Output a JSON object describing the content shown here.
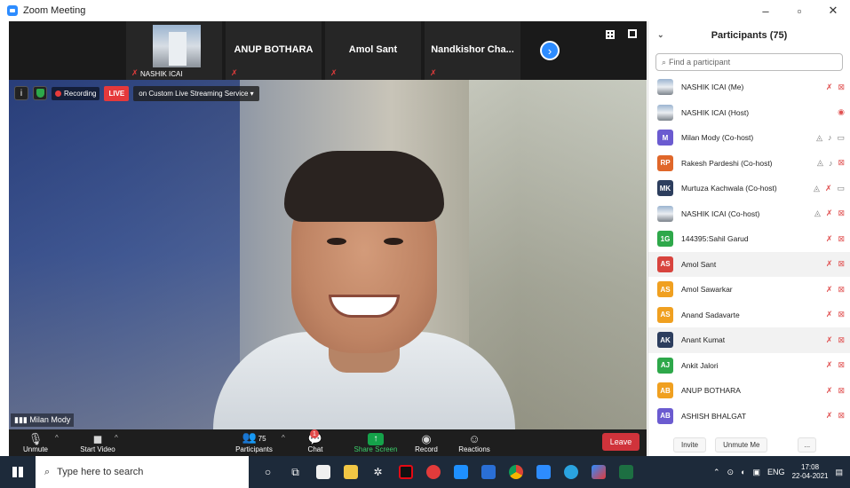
{
  "window": {
    "title": "Zoom Meeting",
    "controls": [
      "–",
      "▫",
      "✕"
    ]
  },
  "thumbnails": [
    {
      "name": "",
      "small_label": "NASHIK ICAI",
      "kind": "image"
    },
    {
      "name": "ANUP BOTHARA",
      "small_label": "",
      "kind": "name"
    },
    {
      "name": "Amol Sant",
      "small_label": "",
      "kind": "name"
    },
    {
      "name": "Nandkishor Cha...",
      "small_label": "",
      "kind": "name"
    }
  ],
  "recording": {
    "recording_label": "Recording",
    "live_label": "LIVE",
    "stream_label": "on Custom Live Streaming Service ▾"
  },
  "speaker": {
    "label": "Milan Mody"
  },
  "toolbar": {
    "unmute": "Unmute",
    "start_video": "Start Video",
    "participants": "Participants",
    "participants_count": "75",
    "chat": "Chat",
    "chat_badge": "1",
    "share_screen": "Share Screen",
    "record": "Record",
    "reactions": "Reactions",
    "leave": "Leave"
  },
  "panel": {
    "title": "Participants (75)",
    "search_placeholder": "Find a participant",
    "invite": "Invite",
    "unmute_me": "Unmute Me",
    "more": "...",
    "participants": [
      {
        "initials": "",
        "name": "NASHIK ICAI (Me)",
        "color": "",
        "img": true,
        "icons": [
          "mic-off",
          "cam-off"
        ]
      },
      {
        "initials": "",
        "name": "NASHIK ICAI (Host)",
        "color": "",
        "img": true,
        "icons": [
          "host-badge"
        ]
      },
      {
        "initials": "M",
        "name": "Milan Mody (Co-host)",
        "color": "#6b5bd0",
        "img": false,
        "icons": [
          "co",
          "mic",
          "cam"
        ]
      },
      {
        "initials": "RP",
        "name": "Rakesh Pardeshi (Co-host)",
        "color": "#e0672a",
        "img": false,
        "icons": [
          "co",
          "mic",
          "cam-off"
        ]
      },
      {
        "initials": "MK",
        "name": "Murtuza Kachwala (Co-host)",
        "color": "#2d3e5e",
        "img": false,
        "icons": [
          "co",
          "mic-off",
          "cam"
        ]
      },
      {
        "initials": "",
        "name": "NASHIK ICAI (Co-host)",
        "color": "",
        "img": true,
        "icons": [
          "co",
          "mic-off",
          "cam-off"
        ]
      },
      {
        "initials": "1G",
        "name": "144395:Sahil Garud",
        "color": "#2ea84a",
        "img": false,
        "icons": [
          "mic-off",
          "cam-off"
        ]
      },
      {
        "initials": "AS",
        "name": "Amol Sant",
        "color": "#d8443e",
        "img": false,
        "icons": [
          "mic-off",
          "cam-off"
        ]
      },
      {
        "initials": "AS",
        "name": "Amol Sawarkar",
        "color": "#f0a020",
        "img": false,
        "icons": [
          "mic-off",
          "cam-off"
        ]
      },
      {
        "initials": "AS",
        "name": "Anand Sadavarte",
        "color": "#f0a020",
        "img": false,
        "icons": [
          "mic-off",
          "cam-off"
        ]
      },
      {
        "initials": "AK",
        "name": "Anant Kumat",
        "color": "#2d3e5e",
        "img": false,
        "icons": [
          "mic-off",
          "cam-off"
        ]
      },
      {
        "initials": "AJ",
        "name": "Ankit Jalori",
        "color": "#2ea84a",
        "img": false,
        "icons": [
          "mic-off",
          "cam-off"
        ]
      },
      {
        "initials": "AB",
        "name": "ANUP BOTHARA",
        "color": "#f0a020",
        "img": false,
        "icons": [
          "mic-off",
          "cam-off"
        ]
      },
      {
        "initials": "AB",
        "name": "ASHISH BHALGAT",
        "color": "#6b5bd0",
        "img": false,
        "icons": [
          "mic-off",
          "cam-off"
        ]
      }
    ]
  },
  "taskbar": {
    "search_placeholder": "Type here to search",
    "lang": "ENG",
    "time": "17:08",
    "date": "22-04-2021"
  }
}
